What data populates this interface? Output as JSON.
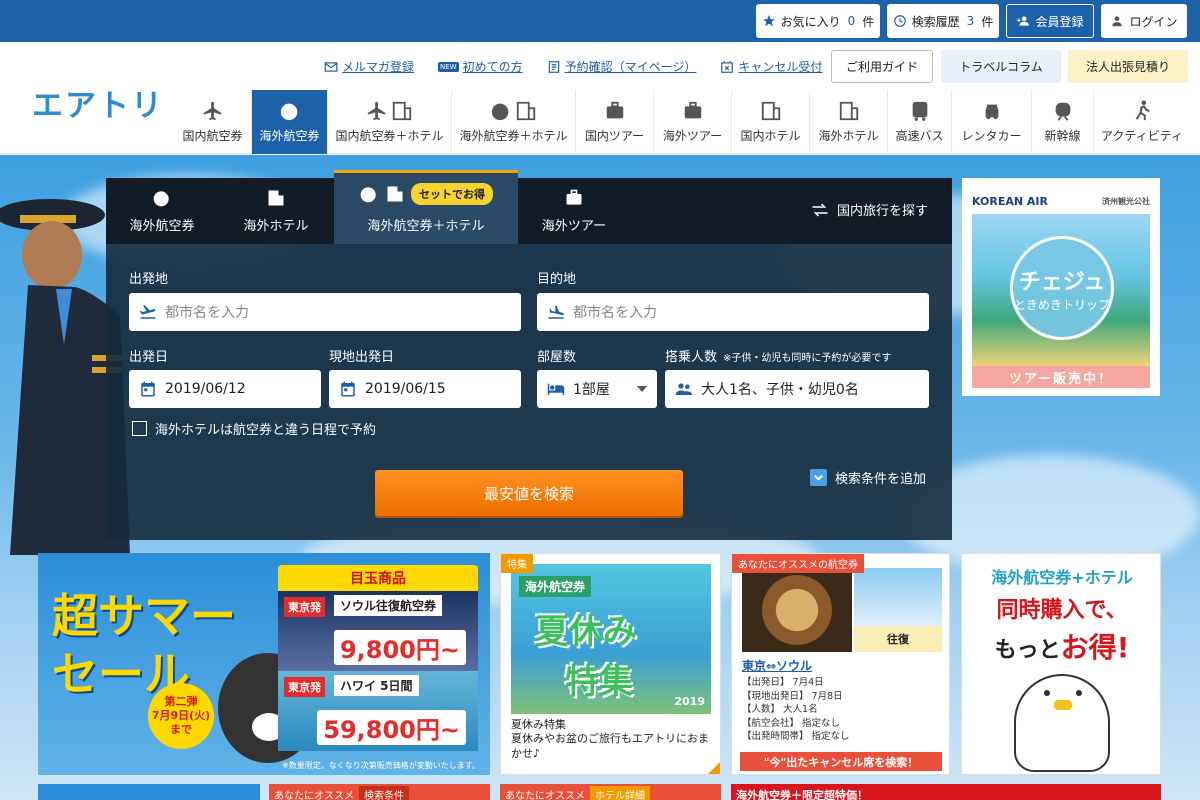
{
  "topbar": {
    "favorites": {
      "label": "お気に入り",
      "count": "0",
      "unit": "件"
    },
    "history": {
      "label": "検索履歴",
      "count": "3",
      "unit": "件"
    },
    "register": "会員登録",
    "login": "ログイン"
  },
  "header": {
    "logo": "エアトリ",
    "links": [
      {
        "label": "メルマガ登録",
        "icon": "mail-icon"
      },
      {
        "label": "初めての方",
        "icon": "new-icon"
      },
      {
        "label": "予約確認（マイページ）",
        "icon": "document-icon"
      },
      {
        "label": "キャンセル受付",
        "icon": "calendar-x-icon"
      }
    ],
    "guide": "ご利用ガイド",
    "column": "トラベルコラム",
    "corporate": "法人出張見積り",
    "new_badge": "NEW"
  },
  "nav": [
    {
      "label": "国内航空券",
      "icon": "plane-icon"
    },
    {
      "label": "海外航空券",
      "icon": "globe-plane-icon",
      "active": true
    },
    {
      "label": "国内航空券＋ホテル",
      "icon": "plane-hotel-icon"
    },
    {
      "label": "海外航空券＋ホテル",
      "icon": "globe-hotel-icon"
    },
    {
      "label": "国内ツアー",
      "icon": "suitcase-icon"
    },
    {
      "label": "海外ツアー",
      "icon": "suitcase-globe-icon"
    },
    {
      "label": "国内ホテル",
      "icon": "hotel-icon"
    },
    {
      "label": "海外ホテル",
      "icon": "hotel-globe-icon"
    },
    {
      "label": "高速バス",
      "icon": "bus-icon"
    },
    {
      "label": "レンタカー",
      "icon": "car-icon"
    },
    {
      "label": "新幹線",
      "icon": "train-icon"
    },
    {
      "label": "アクティビティ",
      "icon": "activity-icon"
    }
  ],
  "search": {
    "tabs": [
      {
        "label": "海外航空券"
      },
      {
        "label": "海外ホテル"
      },
      {
        "label": "海外航空券＋ホテル",
        "badge": "セットでお得",
        "active": true
      },
      {
        "label": "海外ツアー"
      }
    ],
    "domestic_link": "国内旅行を探す",
    "origin_label": "出発地",
    "origin_placeholder": "都市名を入力",
    "destination_label": "目的地",
    "destination_placeholder": "都市名を入力",
    "depart_label": "出発日",
    "depart_value": "2019/06/12",
    "local_depart_label": "現地出発日",
    "local_depart_value": "2019/06/15",
    "rooms_label": "部屋数",
    "rooms_value": "1部屋",
    "passengers_label": "搭乗人数",
    "passengers_note": "※子供・幼児も同時に予約が必要です",
    "passengers_value": "大人1名、子供・幼児0名",
    "checkbox_label": "海外ホテルは航空券と違う日程で予約",
    "search_button": "最安値を検索",
    "add_conditions": "検索条件を追加"
  },
  "ad_jeju": {
    "airline": "KOREAN AIR",
    "sponsor": "済州観光公社",
    "title": "チェジュ",
    "subtitle": "ときめきトリップ",
    "footer": "ツアー販売中！"
  },
  "cards": {
    "summer_sale": {
      "title_line1": "超サマー",
      "title_line2": "セール",
      "badge_line1": "第二弾",
      "badge_line2": "7月9日(火)",
      "badge_line3": "まで",
      "header": "目玉商品",
      "deal1_dep": "東京発",
      "deal1_route": "ソウル往復航空券",
      "deal1_price": "9,800円~",
      "deal2_dep": "東京発",
      "deal2_route": "ハワイ 5日間",
      "deal2_price": "59,800円~",
      "note": "※数量限定。なくなり次第販売価格が変動いたします。"
    },
    "summer_feature": {
      "tag": "特集",
      "img_label": "海外航空券",
      "img_line1": "夏休み",
      "img_line2": "特集",
      "img_year": "2019",
      "title": "夏休み特集",
      "desc": "夏休みやお盆のご旅行もエアトリにおまかせ♪"
    },
    "recommended_flight": {
      "tag": "あなたにオススメの航空券",
      "round": "往復",
      "route": "東京⇔ソウル",
      "lines": [
        "【出発日】 7月4日",
        "【現地出発日】 7月8日",
        "【人数】 大人1名",
        "【航空会社】 指定なし",
        "【出発時間帯】 指定なし"
      ],
      "cta": "\"今\"出たキャンセル席を検索！"
    },
    "combo": {
      "line1": "海外航空券+ホテル",
      "line2": "同時購入で、",
      "line3a": "もっと",
      "line3b": "お得!"
    }
  },
  "bottom_strip": {
    "recommend1": "あなたにオススメ",
    "search_cond": "検索条件",
    "recommend2": "あなたにオススメ",
    "hotel_detail": "ホテル詳細",
    "special": "海外航空券＋限定超特価！"
  },
  "colors": {
    "primary": "#1d62a8",
    "accent_orange": "#ec6d00",
    "badge_yellow": "#f8d22e",
    "tag_red": "#e8503a"
  }
}
